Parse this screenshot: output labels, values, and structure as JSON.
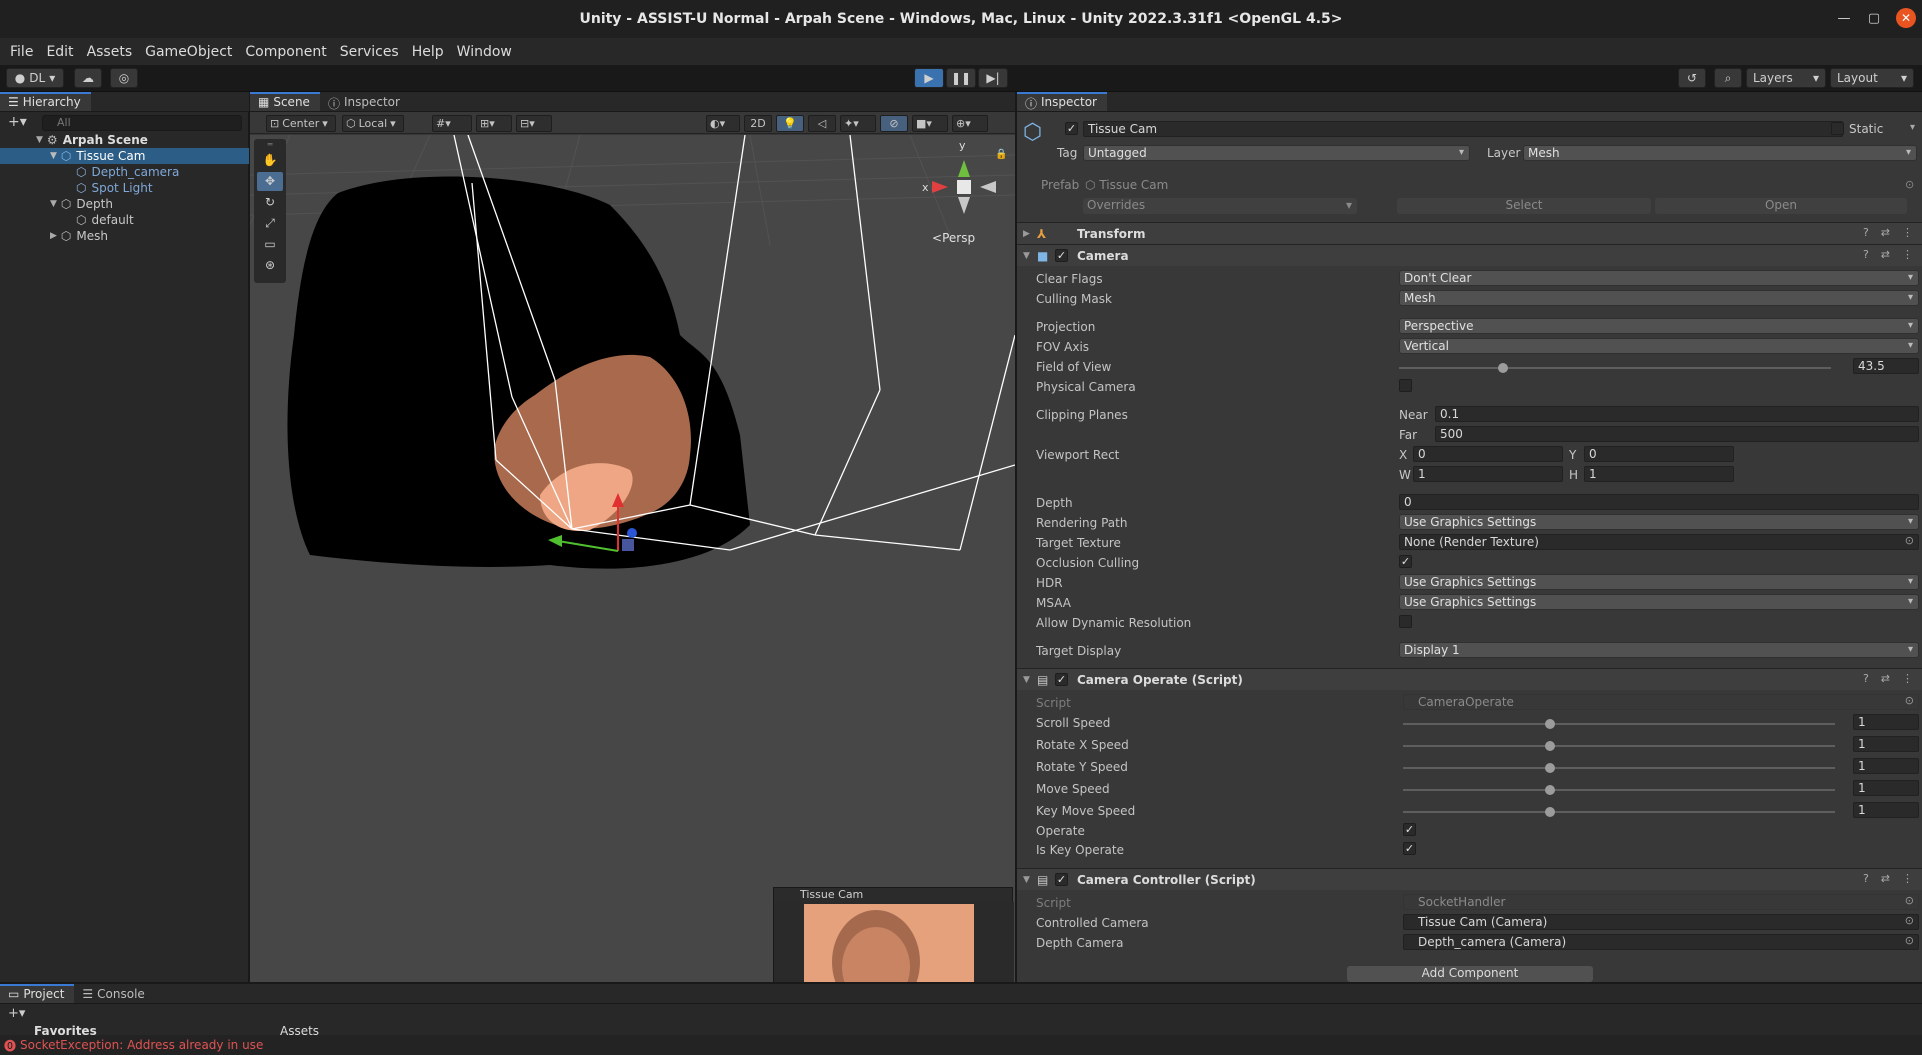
{
  "window": {
    "title": "Unity - ASSIST-U Normal - Arpah Scene - Windows, Mac, Linux - Unity 2022.3.31f1 <OpenGL 4.5>"
  },
  "menu": [
    "File",
    "Edit",
    "Assets",
    "GameObject",
    "Component",
    "Services",
    "Help",
    "Window"
  ],
  "toolbar": {
    "account": "DL",
    "layers": "Layers",
    "layout": "Layout"
  },
  "hierarchy": {
    "tab": "Hierarchy",
    "search_placeholder": "All",
    "items": [
      {
        "label": "Arpah Scene"
      },
      {
        "label": "Tissue Cam"
      },
      {
        "label": "Depth_camera"
      },
      {
        "label": "Spot Light"
      },
      {
        "label": "Depth"
      },
      {
        "label": "default"
      },
      {
        "label": "Mesh"
      }
    ]
  },
  "scene": {
    "tabs": [
      "Scene",
      "Inspector"
    ],
    "pivot": "Center",
    "space": "Local",
    "mode_2d": "2D",
    "persp": "Persp",
    "gizmo_y": "y",
    "gizmo_x": "x",
    "preview_title": "Tissue Cam"
  },
  "inspector": {
    "tab": "Inspector",
    "object_name": "Tissue Cam",
    "static_label": "Static",
    "tag_label": "Tag",
    "tag_value": "Untagged",
    "layer_label": "Layer",
    "layer_value": "Mesh",
    "prefab_label": "Prefab",
    "prefab_value": "Tissue Cam",
    "overrides": "Overrides",
    "select": "Select",
    "open": "Open",
    "transform": "Transform",
    "camera": {
      "title": "Camera",
      "clear_flags_label": "Clear Flags",
      "clear_flags": "Don't Clear",
      "culling_mask_label": "Culling Mask",
      "culling_mask": "Mesh",
      "projection_label": "Projection",
      "projection": "Perspective",
      "fov_axis_label": "FOV Axis",
      "fov_axis": "Vertical",
      "fov_label": "Field of View",
      "fov": "43.5",
      "fov_fraction": 0.24,
      "physical_label": "Physical Camera",
      "clipping_label": "Clipping Planes",
      "near_label": "Near",
      "near": "0.1",
      "far_label": "Far",
      "far": "500",
      "viewport_label": "Viewport Rect",
      "x_label": "X",
      "x": "0",
      "y_label": "Y",
      "y": "0",
      "w_label": "W",
      "w": "1",
      "h_label": "H",
      "h": "1",
      "depth_label": "Depth",
      "depth": "0",
      "rendering_path_label": "Rendering Path",
      "rendering_path": "Use Graphics Settings",
      "target_texture_label": "Target Texture",
      "target_texture": "None (Render Texture)",
      "occlusion_label": "Occlusion Culling",
      "hdr_label": "HDR",
      "hdr": "Use Graphics Settings",
      "msaa_label": "MSAA",
      "msaa": "Use Graphics Settings",
      "dynres_label": "Allow Dynamic Resolution",
      "target_display_label": "Target Display",
      "target_display": "Display 1"
    },
    "camera_operate": {
      "title": "Camera Operate (Script)",
      "script_label": "Script",
      "script": "CameraOperate",
      "sliders": [
        {
          "label": "Scroll Speed",
          "value": "1",
          "fraction": 0.34
        },
        {
          "label": "Rotate X Speed",
          "value": "1",
          "fraction": 0.34
        },
        {
          "label": "Rotate Y Speed",
          "value": "1",
          "fraction": 0.34
        },
        {
          "label": "Move Speed",
          "value": "1",
          "fraction": 0.34
        },
        {
          "label": "Key Move Speed",
          "value": "1",
          "fraction": 0.34
        }
      ],
      "operate_label": "Operate",
      "is_key_operate_label": "Is Key Operate"
    },
    "camera_controller": {
      "title": "Camera Controller (Script)",
      "script_label": "Script",
      "script": "SocketHandler",
      "controlled_label": "Controlled Camera",
      "controlled": "Tissue Cam (Camera)",
      "depth_cam_label": "Depth Camera",
      "depth_cam": "Depth_camera (Camera)"
    },
    "add_component": "Add Component"
  },
  "bottom": {
    "tabs": [
      "Project",
      "Console"
    ],
    "favorites": "Favorites",
    "assets": "Assets"
  },
  "status": {
    "error": "SocketException: Address already in use"
  }
}
